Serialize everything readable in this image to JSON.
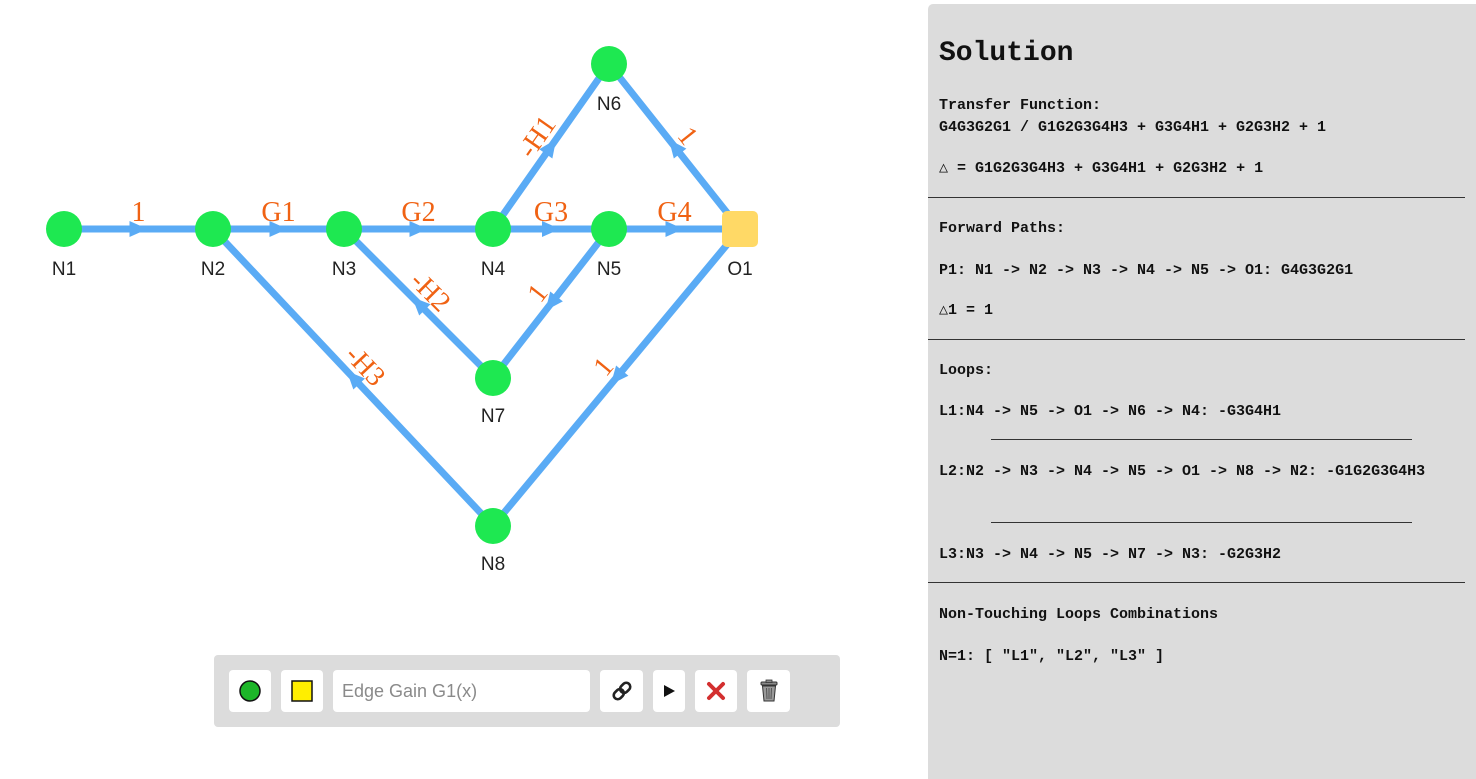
{
  "graph": {
    "colors": {
      "node": "#1ee851",
      "output_node": "#ffd966",
      "edge": "#5aabf5",
      "gain_label": "#f06213"
    },
    "nodes": [
      {
        "id": "N1",
        "label": "N1",
        "kind": "node"
      },
      {
        "id": "N2",
        "label": "N2",
        "kind": "node"
      },
      {
        "id": "N3",
        "label": "N3",
        "kind": "node"
      },
      {
        "id": "N4",
        "label": "N4",
        "kind": "node"
      },
      {
        "id": "N5",
        "label": "N5",
        "kind": "node"
      },
      {
        "id": "O1",
        "label": "O1",
        "kind": "output"
      },
      {
        "id": "N6",
        "label": "N6",
        "kind": "node"
      },
      {
        "id": "N7",
        "label": "N7",
        "kind": "node"
      },
      {
        "id": "N8",
        "label": "N8",
        "kind": "node"
      }
    ],
    "edges": [
      {
        "from": "N1",
        "to": "N2",
        "gain": "1"
      },
      {
        "from": "N2",
        "to": "N3",
        "gain": "G1"
      },
      {
        "from": "N3",
        "to": "N4",
        "gain": "G2"
      },
      {
        "from": "N4",
        "to": "N5",
        "gain": "G3"
      },
      {
        "from": "N5",
        "to": "O1",
        "gain": "G4"
      },
      {
        "from": "N4",
        "to": "N6",
        "gain": "-H1"
      },
      {
        "from": "O1",
        "to": "N6",
        "gain": "1"
      },
      {
        "from": "N5",
        "to": "N7",
        "gain": "1"
      },
      {
        "from": "N7",
        "to": "N3",
        "gain": "-H2"
      },
      {
        "from": "N8",
        "to": "N2",
        "gain": "-H3"
      },
      {
        "from": "O1",
        "to": "N8",
        "gain": "1"
      }
    ]
  },
  "toolbar": {
    "node_icon": "green-circle-icon",
    "output_icon": "yellow-square-icon",
    "edge_gain_placeholder": "Edge Gain G1(x)",
    "link_icon": "link-icon",
    "run_icon": "play-icon",
    "delete_icon": "red-x-icon",
    "trash_icon": "trash-icon"
  },
  "solution": {
    "title": "Solution",
    "transfer_function_label": "Transfer Function:",
    "transfer_function": "G4G3G2G1 / G1G2G3G4H3 + G3G4H1 + G2G3H2 + 1",
    "delta": "△ = G1G2G3G4H3 + G3G4H1 + G2G3H2 + 1",
    "forward_paths_label": "Forward Paths:",
    "forward_paths": [
      {
        "path": "P1: N1 -> N2 -> N3 -> N4 -> N5 -> O1: G4G3G2G1",
        "delta": "△1 = 1"
      }
    ],
    "loops_label": "Loops:",
    "loops": [
      "L1:N4 -> N5 -> O1 -> N6 -> N4: -G3G4H1",
      "L2:N2 -> N3 -> N4 -> N5 -> O1 -> N8 -> N2: -G1G2G3G4H3",
      "L3:N3 -> N4 -> N5 -> N7 -> N3: -G2G3H2"
    ],
    "non_touching_label": "Non-Touching Loops Combinations",
    "non_touching": [
      "N=1: [ \"L1\", \"L2\", \"L3\" ]"
    ]
  }
}
